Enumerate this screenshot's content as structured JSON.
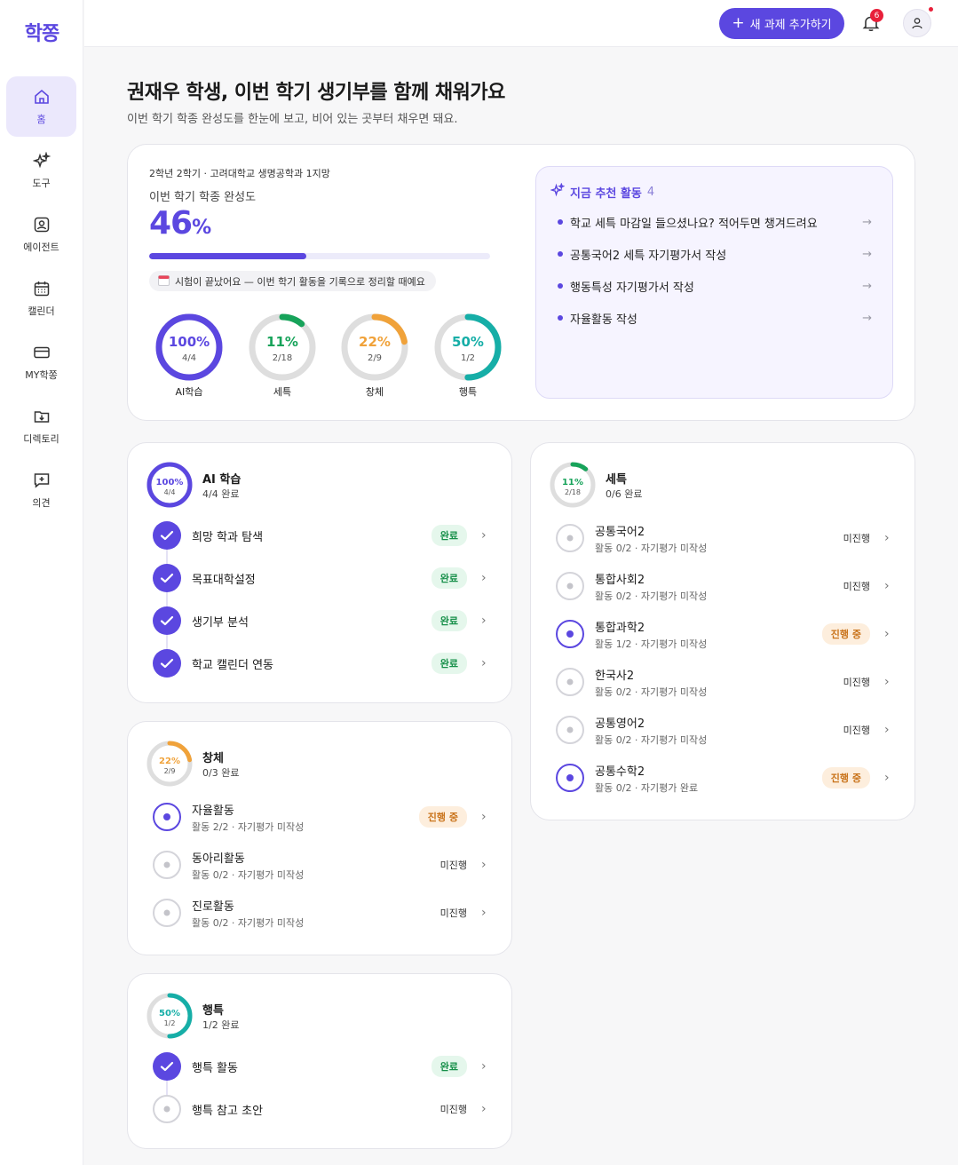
{
  "brand": {
    "logo": "학쫑",
    "accent": "#5b47e0"
  },
  "sidebar": {
    "items": [
      {
        "label": "홈",
        "icon": "home-icon",
        "active": true
      },
      {
        "label": "도구",
        "icon": "sparkles-icon",
        "active": false
      },
      {
        "label": "에이전트",
        "icon": "agent-icon",
        "active": false
      },
      {
        "label": "캘린더",
        "icon": "calendar-icon",
        "active": false
      },
      {
        "label": "MY학쫑",
        "icon": "card-icon",
        "active": false
      },
      {
        "label": "디렉토리",
        "icon": "folder-download-icon",
        "active": false
      },
      {
        "label": "의견",
        "icon": "feedback-icon",
        "active": false
      }
    ]
  },
  "topbar": {
    "new_task_label": "새 과제 추가하기",
    "notification_count": "6"
  },
  "header": {
    "title": "권재우 학생, 이번 학기 생기부를 함께 채워가요",
    "subtitle": "이번 학기 학종 완성도를 한눈에 보고, 비어 있는 곳부터 채우면 돼요."
  },
  "summary": {
    "meta": "2학년 2학기 · 고려대학교 생명공학과 1지망",
    "label": "이번 학기 학종 완성도",
    "percent": "46",
    "percent_unit": "%",
    "progress": 0.46,
    "notice_icon": "calendar-page-icon",
    "notice": "시험이 끝났어요 — 이번 학기 활동을 기록으로 정리할 때예요",
    "rings": [
      {
        "pct": "100%",
        "count": "4/4",
        "label": "AI학습",
        "value": 1.0,
        "color": "#5b47e0"
      },
      {
        "pct": "11%",
        "count": "2/18",
        "label": "세특",
        "value": 0.11,
        "color": "#17a35a"
      },
      {
        "pct": "22%",
        "count": "2/9",
        "label": "창체",
        "value": 0.22,
        "color": "#f0a23a"
      },
      {
        "pct": "50%",
        "count": "1/2",
        "label": "행특",
        "value": 0.5,
        "color": "#16aea7"
      }
    ]
  },
  "recommend": {
    "title": "지금 추천 활동",
    "count": "4",
    "items": [
      "학교 세특 마감일 들으셨나요? 적어두면 챙겨드려요",
      "공통국어2 세특 자기평가서 작성",
      "행동특성 자기평가서 작성",
      "자율활동 작성"
    ]
  },
  "ai": {
    "title": "AI 학습",
    "sub": "4/4 완료",
    "pct": "100%",
    "count": "4/4",
    "value": 1.0,
    "color": "#5b47e0",
    "items": [
      {
        "title": "희망 학과 탐색",
        "badge": "완료"
      },
      {
        "title": "목표대학설정",
        "badge": "완료"
      },
      {
        "title": "생기부 분석",
        "badge": "완료"
      },
      {
        "title": "학교 캘린더 연동",
        "badge": "완료"
      }
    ]
  },
  "changche": {
    "title": "창체",
    "sub": "0/3 완료",
    "pct": "22%",
    "count": "2/9",
    "value": 0.22,
    "color": "#f0a23a",
    "items": [
      {
        "title": "자율활동",
        "sub": "활동 2/2 · 자기평가 미작성",
        "badge": "진행 중",
        "state": "prog"
      },
      {
        "title": "동아리활동",
        "sub": "활동 0/2 · 자기평가 미작성",
        "badge": "미진행",
        "state": "todo"
      },
      {
        "title": "진로활동",
        "sub": "활동 0/2 · 자기평가 미작성",
        "badge": "미진행",
        "state": "todo"
      }
    ]
  },
  "haengteuk": {
    "title": "행특",
    "sub": "1/2 완료",
    "pct": "50%",
    "count": "1/2",
    "value": 0.5,
    "color": "#16aea7",
    "items": [
      {
        "title": "행특 활동",
        "badge": "완료",
        "state": "done"
      },
      {
        "title": "행특 참고 초안",
        "badge": "미진행",
        "state": "todo"
      }
    ]
  },
  "seteuk": {
    "title": "세특",
    "sub": "0/6 완료",
    "pct": "11%",
    "count": "2/18",
    "value": 0.11,
    "color": "#17a35a",
    "items": [
      {
        "title": "공통국어2",
        "sub": "활동 0/2 · 자기평가 미작성",
        "badge": "미진행",
        "state": "todo"
      },
      {
        "title": "통합사회2",
        "sub": "활동 0/2 · 자기평가 미작성",
        "badge": "미진행",
        "state": "todo"
      },
      {
        "title": "통합과학2",
        "sub": "활동 1/2 · 자기평가 미작성",
        "badge": "진행 중",
        "state": "prog"
      },
      {
        "title": "한국사2",
        "sub": "활동 0/2 · 자기평가 미작성",
        "badge": "미진행",
        "state": "todo"
      },
      {
        "title": "공통영어2",
        "sub": "활동 0/2 · 자기평가 미작성",
        "badge": "미진행",
        "state": "todo"
      },
      {
        "title": "공통수학2",
        "sub": "활동 0/2 · 자기평가 완료",
        "badge": "진행 중",
        "state": "prog"
      }
    ]
  }
}
